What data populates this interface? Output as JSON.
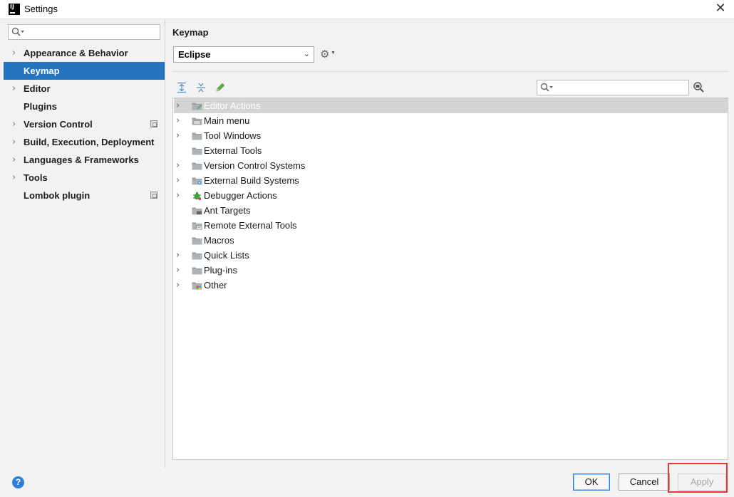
{
  "window": {
    "title": "Settings",
    "close_icon": "close-icon"
  },
  "sidebar": {
    "search_placeholder": "",
    "items": [
      {
        "label": "Appearance & Behavior",
        "expandable": true,
        "selected": false,
        "project_icon": false
      },
      {
        "label": "Keymap",
        "expandable": false,
        "selected": true,
        "project_icon": false
      },
      {
        "label": "Editor",
        "expandable": true,
        "selected": false,
        "project_icon": false
      },
      {
        "label": "Plugins",
        "expandable": false,
        "selected": false,
        "project_icon": false
      },
      {
        "label": "Version Control",
        "expandable": true,
        "selected": false,
        "project_icon": true
      },
      {
        "label": "Build, Execution, Deployment",
        "expandable": true,
        "selected": false,
        "project_icon": false
      },
      {
        "label": "Languages & Frameworks",
        "expandable": true,
        "selected": false,
        "project_icon": false
      },
      {
        "label": "Tools",
        "expandable": true,
        "selected": false,
        "project_icon": false
      },
      {
        "label": "Lombok plugin",
        "expandable": false,
        "selected": false,
        "project_icon": true
      }
    ]
  },
  "main": {
    "title": "Keymap",
    "keymap_select": {
      "value": "Eclipse"
    },
    "toolbar": {
      "expand_all": "expand-all-icon",
      "collapse_all": "collapse-all-icon",
      "edit": "pencil-icon"
    },
    "search_placeholder": "",
    "tree": [
      {
        "label": "Editor Actions",
        "expandable": true,
        "selected": true,
        "icon": "folder-edit"
      },
      {
        "label": "Main menu",
        "expandable": true,
        "selected": false,
        "icon": "folder-menu"
      },
      {
        "label": "Tool Windows",
        "expandable": true,
        "selected": false,
        "icon": "folder"
      },
      {
        "label": "External Tools",
        "expandable": false,
        "selected": false,
        "icon": "folder"
      },
      {
        "label": "Version Control Systems",
        "expandable": true,
        "selected": false,
        "icon": "folder"
      },
      {
        "label": "External Build Systems",
        "expandable": true,
        "selected": false,
        "icon": "folder-gear"
      },
      {
        "label": "Debugger Actions",
        "expandable": true,
        "selected": false,
        "icon": "bug"
      },
      {
        "label": "Ant Targets",
        "expandable": false,
        "selected": false,
        "icon": "folder-ant"
      },
      {
        "label": "Remote External Tools",
        "expandable": false,
        "selected": false,
        "icon": "folder-remote"
      },
      {
        "label": "Macros",
        "expandable": false,
        "selected": false,
        "icon": "folder"
      },
      {
        "label": "Quick Lists",
        "expandable": true,
        "selected": false,
        "icon": "folder"
      },
      {
        "label": "Plug-ins",
        "expandable": true,
        "selected": false,
        "icon": "folder"
      },
      {
        "label": "Other",
        "expandable": true,
        "selected": false,
        "icon": "folder-other"
      }
    ]
  },
  "buttons": {
    "ok": "OK",
    "cancel": "Cancel",
    "apply": "Apply",
    "help": "?"
  },
  "colors": {
    "selection": "#2675bf",
    "highlight_box": "#e53935",
    "tree_selection": "#d4d4d4"
  }
}
